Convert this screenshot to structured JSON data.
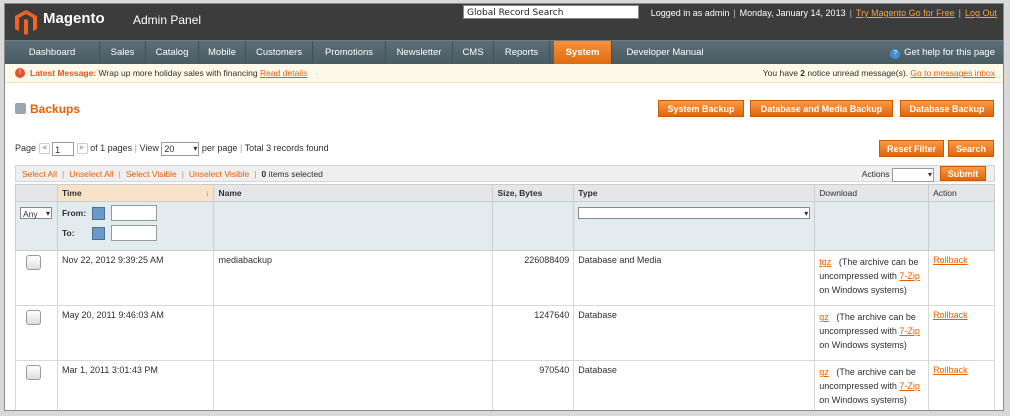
{
  "header": {
    "brand": "Magento",
    "brand_sub": "Admin Panel",
    "global_search_placeholder": "Global Record Search",
    "logged_in": "Logged in as admin",
    "date": "Monday, January 14, 2013",
    "try_link": "Try Magento Go for Free",
    "logout": "Log Out"
  },
  "nav": {
    "items": [
      "Dashboard",
      "Sales",
      "Catalog",
      "Mobile",
      "Customers",
      "Promotions",
      "Newsletter",
      "CMS",
      "Reports",
      "System",
      "Developer Manual"
    ],
    "active": "System",
    "help": "Get help for this page"
  },
  "notice": {
    "label": "Latest Message:",
    "text": "Wrap up more holiday sales with financing",
    "link": "Read details",
    "right_prefix": "You have",
    "right_count": "2",
    "right_suffix": "notice unread message(s).",
    "right_link": "Go to messages inbox"
  },
  "page": {
    "title": "Backups",
    "buttons": [
      "System Backup",
      "Database and Media Backup",
      "Database Backup"
    ]
  },
  "pager": {
    "page_label": "Page",
    "page_value": "1",
    "of_pages": "of 1 pages",
    "view_label": "View",
    "view_value": "20",
    "per_page": "per page",
    "total": "Total 3 records found",
    "reset_filter": "Reset Filter",
    "search": "Search"
  },
  "massaction": {
    "select_all": "Select All",
    "unselect_all": "Unselect All",
    "select_visible": "Select Visible",
    "unselect_visible": "Unselect Visible",
    "items_selected_count": "0",
    "items_selected": "items selected",
    "actions_label": "Actions",
    "submit": "Submit"
  },
  "grid": {
    "columns": [
      "Time",
      "Name",
      "Size, Bytes",
      "Type",
      "Download",
      "Action"
    ],
    "filter": {
      "any": "Any",
      "from": "From:",
      "to": "To:"
    },
    "rows": [
      {
        "time": "Nov 22, 2012 9:39:25 AM",
        "name": "mediabackup",
        "size": "226088409",
        "type": "Database and Media",
        "dl_link": "tgz",
        "dl_text": "(The archive can be uncompressed with",
        "dl_tool": "7-Zip",
        "dl_tail": "on Windows systems)",
        "action": "Rollback"
      },
      {
        "time": "May 20, 2011 9:46:03 AM",
        "name": "",
        "size": "1247640",
        "type": "Database",
        "dl_link": "gz",
        "dl_text": "(The archive can be uncompressed with",
        "dl_tool": "7-Zip",
        "dl_tail": "on Windows systems)",
        "action": "Rollback"
      },
      {
        "time": "Mar 1, 2011 3:01:43 PM",
        "name": "",
        "size": "970540",
        "type": "Database",
        "dl_link": "gz",
        "dl_text": "(The archive can be uncompressed with",
        "dl_tool": "7-Zip",
        "dl_tail": "on Windows systems)",
        "action": "Rollback"
      }
    ]
  },
  "colors": {
    "accent": "#eb5e00",
    "nav_bg": "#485a62",
    "header_bg": "#3c3c3c"
  }
}
